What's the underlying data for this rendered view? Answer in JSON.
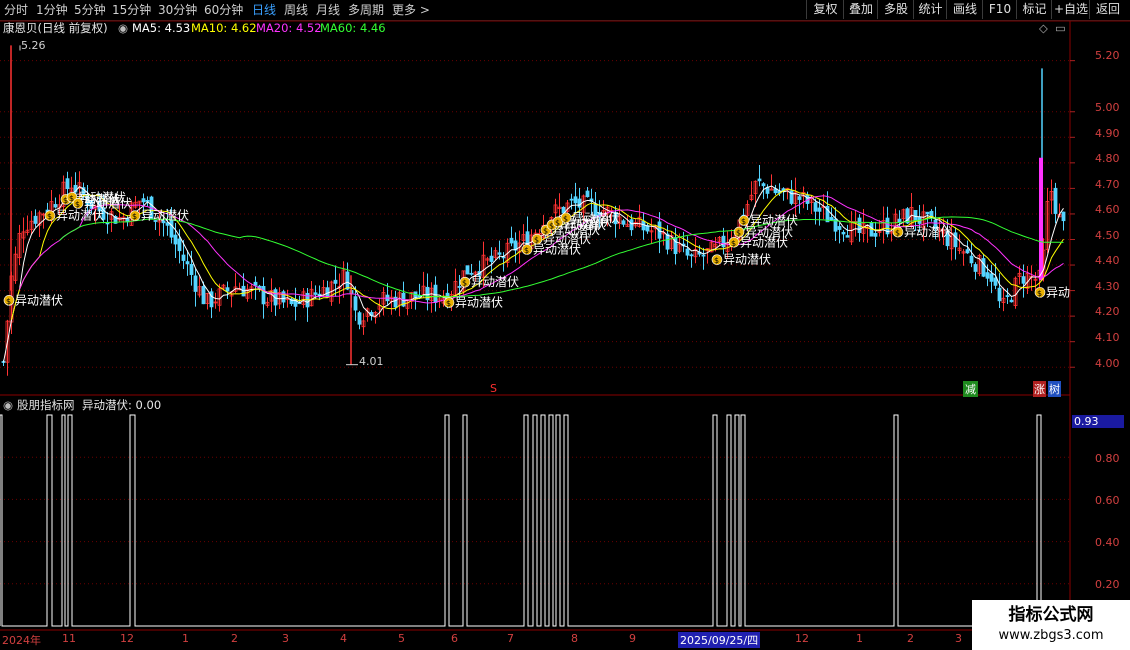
{
  "toolbar": {
    "periods": [
      "分时",
      "1分钟",
      "5分钟",
      "15分钟",
      "30分钟",
      "60分钟",
      "日线",
      "周线",
      "月线",
      "多周期",
      "更多"
    ],
    "active_period": "日线",
    "right_buttons": [
      "复权",
      "叠加",
      "多股",
      "统计",
      "画线",
      "F10",
      "标记",
      "+自选",
      "返回"
    ]
  },
  "main_info": {
    "title": "康恩贝(日线 前复权)",
    "ma5_label": "MA5: 4.53",
    "ma10_label": "MA10: 4.62",
    "ma20_label": "MA20: 4.52",
    "ma60_label": "MA60: 4.46",
    "colors": {
      "ma5": "#ffffff",
      "ma10": "#ffff00",
      "ma20": "#ff33ff",
      "ma60": "#33ff33",
      "up": "#ff3333",
      "down": "#54d4ff",
      "price_axis": "#d24040"
    }
  },
  "price_axis": {
    "ticks": [
      "5.20",
      "5.00",
      "4.90",
      "4.80",
      "4.70",
      "4.60",
      "4.50",
      "4.40",
      "4.30",
      "4.20",
      "4.10",
      "4.00"
    ]
  },
  "annotations": {
    "high": "5.26",
    "low": "4.01",
    "signal_text": "异动潜伏",
    "signal_text_cut": "异动",
    "s_mark": "S",
    "jian": "减",
    "zhang": "涨",
    "shu": "树"
  },
  "sub_panel": {
    "title": "股朋指标网",
    "indicator_label": "异动潜伏: 0.00",
    "current_value": "0.93",
    "ticks": [
      "0.80",
      "0.60",
      "0.40",
      "0.20"
    ]
  },
  "date_axis": {
    "year_label": "2024年",
    "months": [
      "11",
      "12",
      "1",
      "2",
      "3",
      "4",
      "5",
      "6",
      "7",
      "8",
      "9",
      "12",
      "1",
      "2",
      "3"
    ],
    "highlight_date": "2025/09/25/四"
  },
  "chart_data": {
    "type": "candlestick",
    "title": "康恩贝(日线 前复权)",
    "ylim": [
      3.95,
      5.32
    ],
    "moving_averages": {
      "MA5": 4.53,
      "MA10": 4.62,
      "MA20": 4.52,
      "MA60": 4.46
    },
    "high": 5.26,
    "low": 4.01,
    "signal_name": "异动潜伏",
    "signal_value_latest": 0.0,
    "signal_axis_ticks": [
      0.2,
      0.4,
      0.6,
      0.8
    ],
    "signal_cursor_value": 0.93
  },
  "watermark": {
    "line1": "指标公式网",
    "line2": "www.zbgs3.com"
  }
}
